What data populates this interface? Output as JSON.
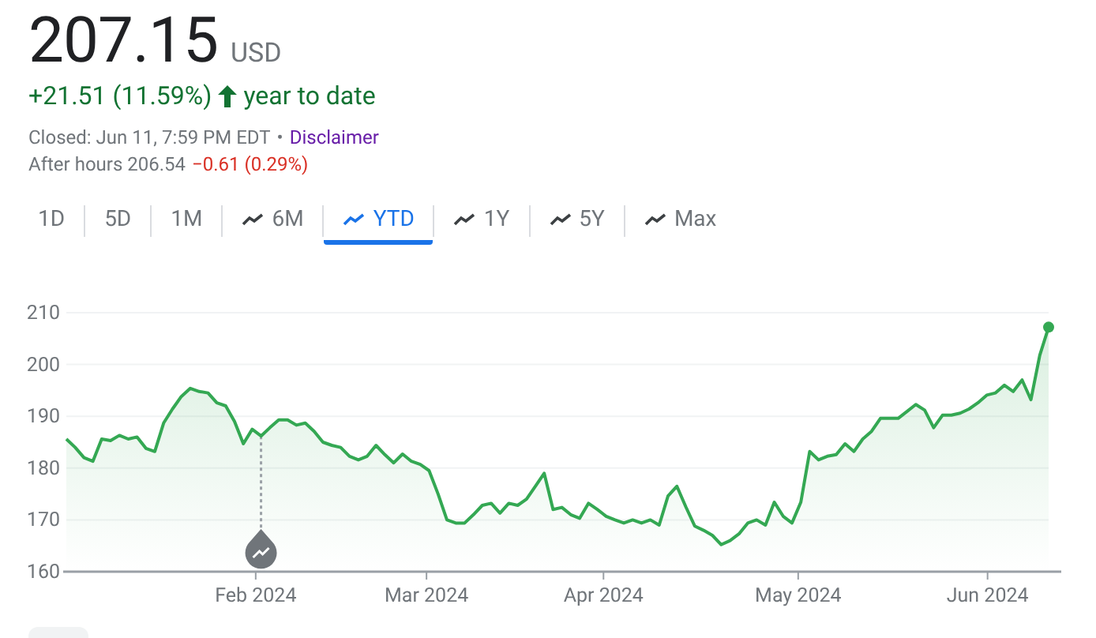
{
  "quote": {
    "price": "207.15",
    "currency": "USD",
    "change": "+21.51 (11.59%)",
    "period": "year to date"
  },
  "status": {
    "closed": "Closed: Jun 11, 7:59 PM EDT",
    "separator": "•",
    "disclaimer": "Disclaimer"
  },
  "after_hours": {
    "label": "After hours 206.54",
    "change": "−0.61 (0.29%)"
  },
  "ranges": [
    {
      "label": "1D",
      "icon": false,
      "selected": false
    },
    {
      "label": "5D",
      "icon": false,
      "selected": false
    },
    {
      "label": "1M",
      "icon": false,
      "selected": false
    },
    {
      "label": "6M",
      "icon": true,
      "selected": false
    },
    {
      "label": "YTD",
      "icon": true,
      "selected": true
    },
    {
      "label": "1Y",
      "icon": true,
      "selected": false
    },
    {
      "label": "5Y",
      "icon": true,
      "selected": false
    },
    {
      "label": "Max",
      "icon": true,
      "selected": false
    }
  ],
  "chart": {
    "month_labels": [
      "Feb 2024",
      "Mar 2024",
      "Apr 2024",
      "May 2024",
      "Jun 2024"
    ],
    "chart_data": {
      "type": "area",
      "grid": true,
      "ylim": [
        160,
        210
      ],
      "yticks": [
        160,
        170,
        180,
        190,
        200,
        210
      ],
      "series": [
        {
          "color": "#34a853",
          "values": [
            185.6,
            184,
            182,
            181.3,
            185.6,
            185.3,
            186.3,
            185.6,
            186,
            183.8,
            183.2,
            188.7,
            191.4,
            193.8,
            195.4,
            194.8,
            194.5,
            192.6,
            192,
            189,
            184.7,
            187.5,
            186.2,
            187.8,
            189.3,
            189.3,
            188.3,
            188.7,
            187.1,
            185,
            184.4,
            184,
            182.3,
            181.6,
            182.3,
            184.4,
            182.6,
            181,
            182.7,
            181.3,
            180.7,
            179.5,
            175,
            170,
            169.4,
            169.4,
            171,
            172.8,
            173.2,
            171.3,
            173.2,
            172.8,
            174,
            176.5,
            179,
            172,
            172.4,
            171,
            170.3,
            173.2,
            172,
            170.7,
            170,
            169.4,
            170,
            169.4,
            170,
            169,
            174.6,
            176.5,
            172.5,
            168.8,
            168,
            167,
            165.2,
            166,
            167.3,
            169.4,
            170,
            169,
            173.4,
            170.7,
            169.4,
            173.4,
            183.2,
            181.6,
            182.3,
            182.6,
            184.7,
            183.2,
            185.6,
            187.1,
            189.6,
            189.6,
            189.6,
            190.9,
            192.3,
            191.2,
            187.8,
            190.2,
            190.2,
            190.6,
            191.4,
            192.6,
            194.1,
            194.5,
            196,
            194.8,
            197,
            193.2,
            201.8,
            207.2
          ]
        }
      ]
    }
  }
}
